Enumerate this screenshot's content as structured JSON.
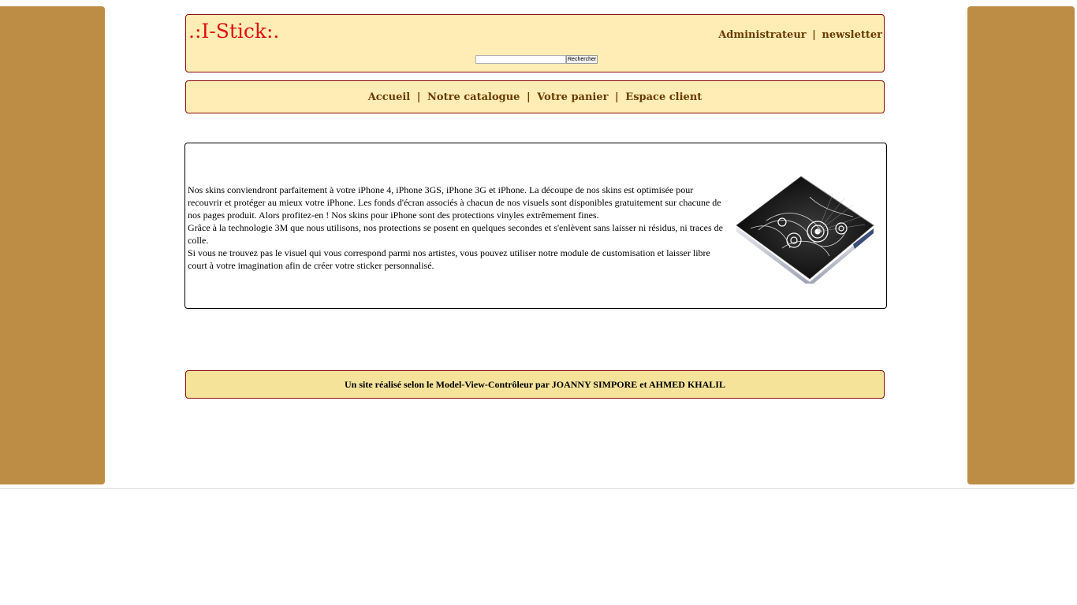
{
  "header": {
    "logo": ".:I-Stick:.",
    "links": [
      {
        "label": "Administrateur"
      },
      {
        "label": "newsletter"
      }
    ],
    "separator": "|",
    "search": {
      "value": "",
      "placeholder": "",
      "button_label": "Rechercher"
    }
  },
  "nav": {
    "items": [
      {
        "label": "Accueil"
      },
      {
        "label": "Notre catalogue"
      },
      {
        "label": "Votre panier"
      },
      {
        "label": "Espace client"
      }
    ],
    "separator": "|"
  },
  "content": {
    "paragraphs": [
      "Nos skins conviendront parfaitement à votre iPhone 4, iPhone 3GS, iPhone 3G et iPhone. La découpe de nos skins est optimisée pour recouvrir et protéger au mieux votre iPhone. Les fonds d'écran associés à chacun de nos visuels sont disponibles gratuitement sur chacune de nos pages produit. Alors profitez-en ! Nos skins pour iPhone sont des protections vinyles extrêmement fines.",
      "Grâce à la technologie 3M que nous utilisons, nos protections se posent en quelques secondes et s'enlèvent sans laisser ni résidus, ni traces de colle.",
      "Si vous ne trouvez pas le visuel qui vous correspond parmi nos artistes, vous pouvez utiliser notre module de customisation et laisser libre court à votre imagination afin de créer votre sticker personnalisé."
    ]
  },
  "footer": {
    "text": "Un site réalisé selon le Model-View-Contrôleur par JOANNY SIMPORE et AHMED KHALIL"
  },
  "colors": {
    "sidebar": "#bd8d46",
    "box_background": "#ffedb5",
    "box_border": "#8b0b0b",
    "logo": "#e01010",
    "link": "#6a3c04",
    "footer_background": "#f5e39a"
  }
}
